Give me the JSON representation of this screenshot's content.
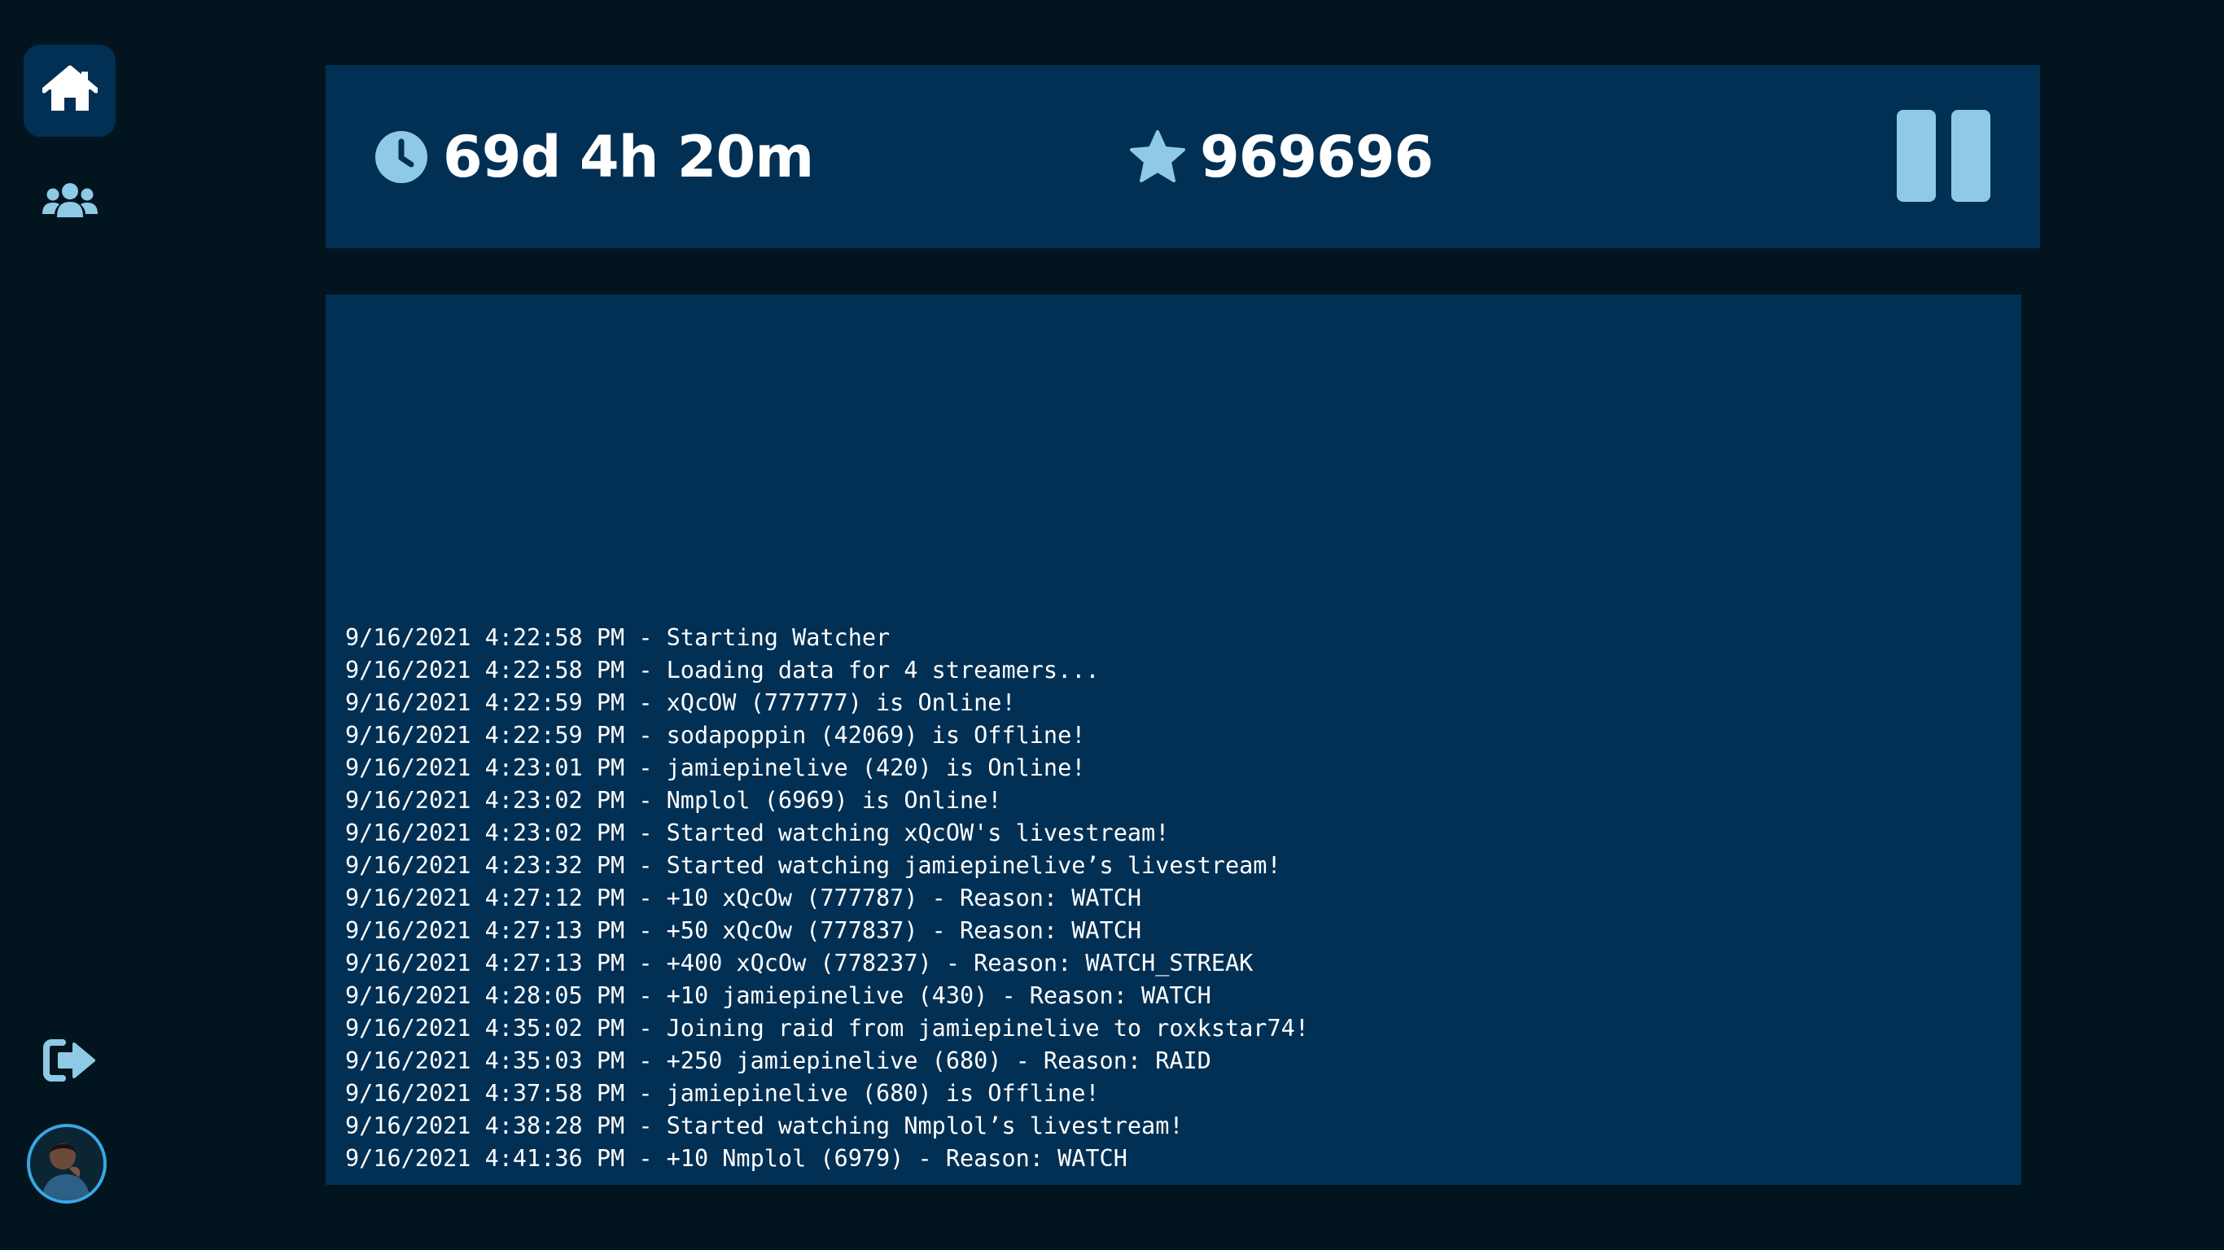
{
  "sidebar": {
    "items": [
      {
        "icon": "home-icon",
        "active": true
      },
      {
        "icon": "users-icon",
        "active": false
      }
    ],
    "logout_icon": "sign-out-icon",
    "avatar_icon": "user-avatar"
  },
  "stats": {
    "watch_time": "69d 4h 20m",
    "watch_time_icon": "clock-icon",
    "points": "969696",
    "points_icon": "star-icon",
    "pause_icon": "pause-icon"
  },
  "colors": {
    "background": "#02151f",
    "panel": "#023054",
    "accent": "#8ecae6",
    "text": "#ffffff",
    "avatar_ring": "#39a7e6"
  },
  "log": [
    "9/16/2021 4:22:58 PM - Starting Watcher",
    "9/16/2021 4:22:58 PM - Loading data for 4 streamers...",
    "9/16/2021 4:22:59 PM - xQcOW (777777) is Online!",
    "9/16/2021 4:22:59 PM - sodapoppin (42069) is Offline!",
    "9/16/2021 4:23:01 PM - jamiepinelive (420) is Online!",
    "9/16/2021 4:23:02 PM - Nmplol (6969) is Online!",
    "9/16/2021 4:23:02 PM - Started watching xQcOW's livestream!",
    "9/16/2021 4:23:32 PM - Started watching jamiepinelive’s livestream!",
    "9/16/2021 4:27:12 PM - +10 xQcOw (777787) - Reason: WATCH",
    "9/16/2021 4:27:13 PM - +50 xQcOw (777837) - Reason: WATCH",
    "9/16/2021 4:27:13 PM - +400 xQcOw (778237) - Reason: WATCH_STREAK",
    "9/16/2021 4:28:05 PM - +10 jamiepinelive (430) - Reason: WATCH",
    "9/16/2021 4:35:02 PM - Joining raid from jamiepinelive to roxkstar74!",
    "9/16/2021 4:35:03 PM - +250 jamiepinelive (680) - Reason: RAID",
    "9/16/2021 4:37:58 PM - jamiepinelive (680) is Offline!",
    "9/16/2021 4:38:28 PM - Started watching Nmplol’s livestream!",
    "9/16/2021 4:41:36 PM - +10 Nmplol (6979) - Reason: WATCH"
  ]
}
